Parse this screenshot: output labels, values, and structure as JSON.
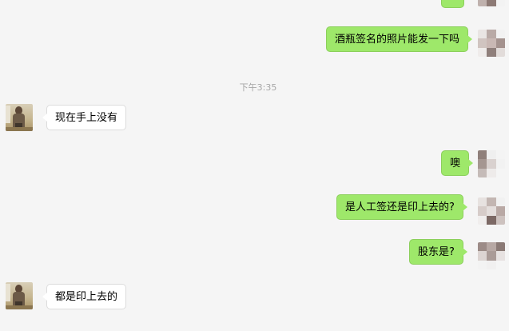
{
  "conversation": {
    "timestamp": "下午3:35",
    "messages": [
      {
        "side": "me",
        "text": ""
      },
      {
        "side": "me",
        "text": "酒瓶签名的照片能发一下吗"
      },
      {
        "side": "them",
        "text": "现在手上没有"
      },
      {
        "side": "me",
        "text": "噢"
      },
      {
        "side": "me",
        "text": "是人工签还是印上去的?"
      },
      {
        "side": "me",
        "text": "股东是?"
      },
      {
        "side": "them",
        "text": "都是印上去的"
      }
    ]
  },
  "colors": {
    "background": "#f5f5f5",
    "my_bubble": "#9ee86a",
    "their_bubble": "#ffffff",
    "timestamp_text": "#a6a6a6"
  },
  "icons": {
    "my_avatar": "pixelated-avatar-icon",
    "their_avatar": "person-photo-avatar-icon"
  }
}
